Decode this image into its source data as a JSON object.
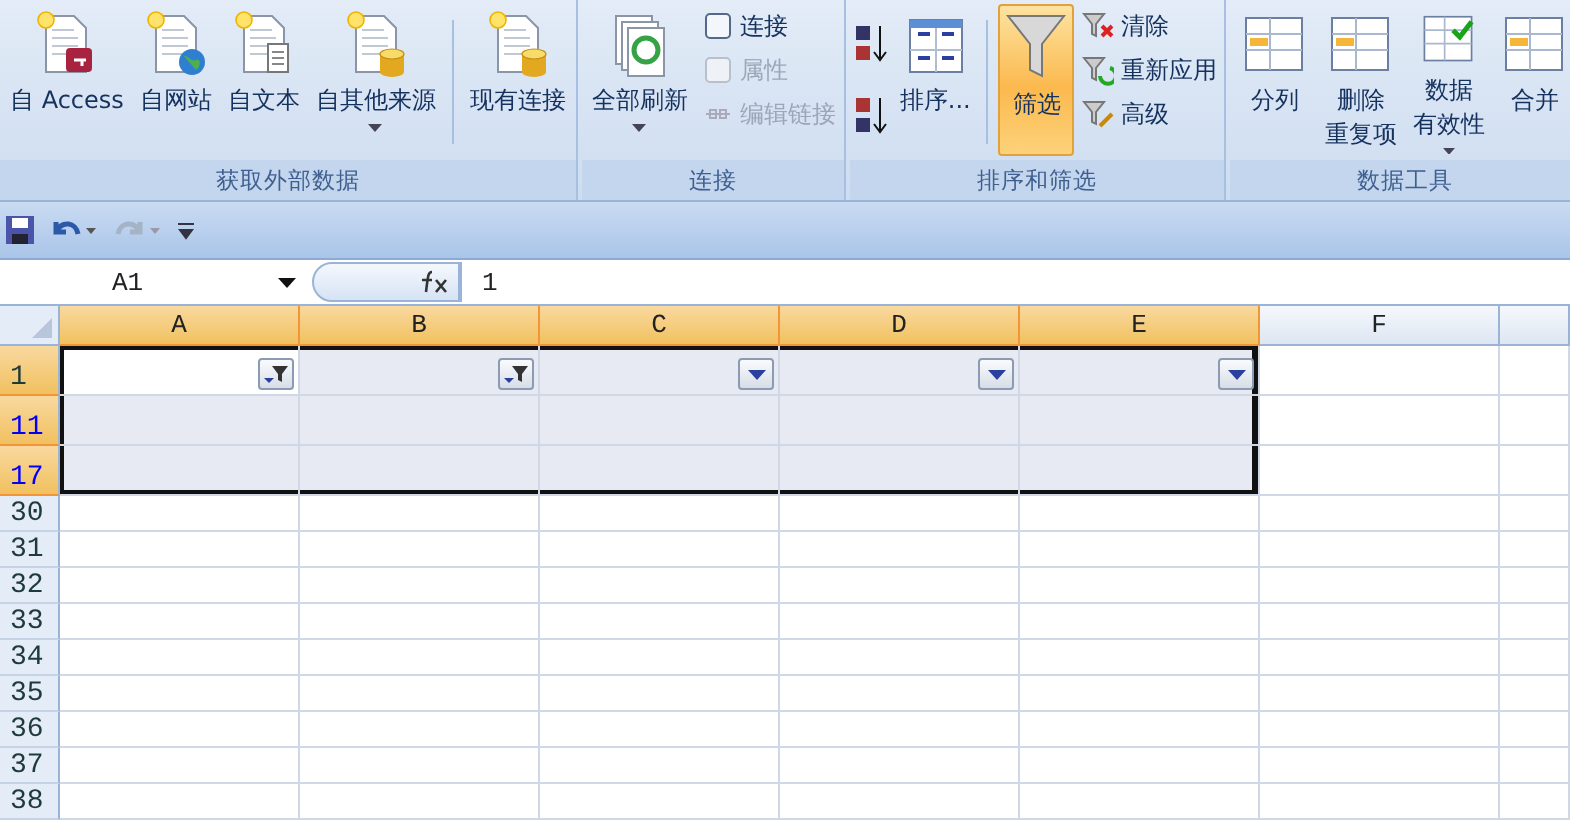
{
  "ribbon": {
    "groups": [
      {
        "label": "获取外部数据",
        "items": [
          {
            "kind": "large",
            "label": "自 Access",
            "dropdown": false
          },
          {
            "kind": "large",
            "label": "自网站",
            "dropdown": false
          },
          {
            "kind": "large",
            "label": "自文本",
            "dropdown": false
          },
          {
            "kind": "large",
            "label": "自其他来源",
            "dropdown": true
          },
          {
            "kind": "separator"
          },
          {
            "kind": "large",
            "label": "现有连接",
            "dropdown": false
          }
        ]
      },
      {
        "label": "连接",
        "items": [
          {
            "kind": "large",
            "label": "全部刷新",
            "dropdown": true
          },
          {
            "kind": "stack",
            "items": [
              {
                "label": "连接",
                "disabled": false
              },
              {
                "label": "属性",
                "disabled": true
              },
              {
                "label": "编辑链接",
                "disabled": true
              }
            ]
          }
        ]
      },
      {
        "label": "排序和筛选",
        "items": [
          {
            "kind": "iconstack"
          },
          {
            "kind": "large",
            "label": "排序...",
            "dropdown": false,
            "selected": false
          },
          {
            "kind": "separator"
          },
          {
            "kind": "large",
            "label": "筛选",
            "dropdown": false,
            "selected": true
          },
          {
            "kind": "stack",
            "items": [
              {
                "label": "清除",
                "disabled": false
              },
              {
                "label": "重新应用",
                "disabled": false
              },
              {
                "label": "高级",
                "disabled": false
              }
            ]
          }
        ]
      },
      {
        "label": "数据工具",
        "items": [
          {
            "kind": "large",
            "label": "分列",
            "dropdown": false
          },
          {
            "kind": "large",
            "lines": [
              "删除",
              "重复项"
            ],
            "dropdown": false
          },
          {
            "kind": "large",
            "lines": [
              "数据",
              "有效性"
            ],
            "dropdown": true
          },
          {
            "kind": "large",
            "label": "合并",
            "dropdown": false
          }
        ]
      }
    ]
  },
  "formula_bar": {
    "name_box": "A1",
    "formula": "1"
  },
  "sheet": {
    "columns": [
      {
        "label": "A",
        "highlighted": true
      },
      {
        "label": "B",
        "highlighted": true
      },
      {
        "label": "C",
        "highlighted": true
      },
      {
        "label": "D",
        "highlighted": true
      },
      {
        "label": "E",
        "highlighted": true
      },
      {
        "label": "F",
        "highlighted": false
      }
    ],
    "rows": [
      {
        "number": "1",
        "in_table": true,
        "filtered": false,
        "cells": [
          {
            "filtered": true,
            "selected": true
          },
          {
            "filtered": true,
            "selected": false
          },
          {
            "filtered": false,
            "selected": false
          },
          {
            "filtered": false,
            "selected": false
          },
          {
            "filtered": false,
            "selected": false
          }
        ]
      },
      {
        "number": "11",
        "in_table": true,
        "filtered": true
      },
      {
        "number": "17",
        "in_table": true,
        "filtered": true
      },
      {
        "number": "30",
        "in_table": false,
        "filtered": false
      },
      {
        "number": "31",
        "in_table": false,
        "filtered": false
      },
      {
        "number": "32",
        "in_table": false,
        "filtered": false
      },
      {
        "number": "33",
        "in_table": false,
        "filtered": false
      },
      {
        "number": "34",
        "in_table": false,
        "filtered": false
      },
      {
        "number": "35",
        "in_table": false,
        "filtered": false
      },
      {
        "number": "36",
        "in_table": false,
        "filtered": false
      },
      {
        "number": "37",
        "in_table": false,
        "filtered": false
      },
      {
        "number": "38",
        "in_table": false,
        "filtered": false
      }
    ]
  }
}
